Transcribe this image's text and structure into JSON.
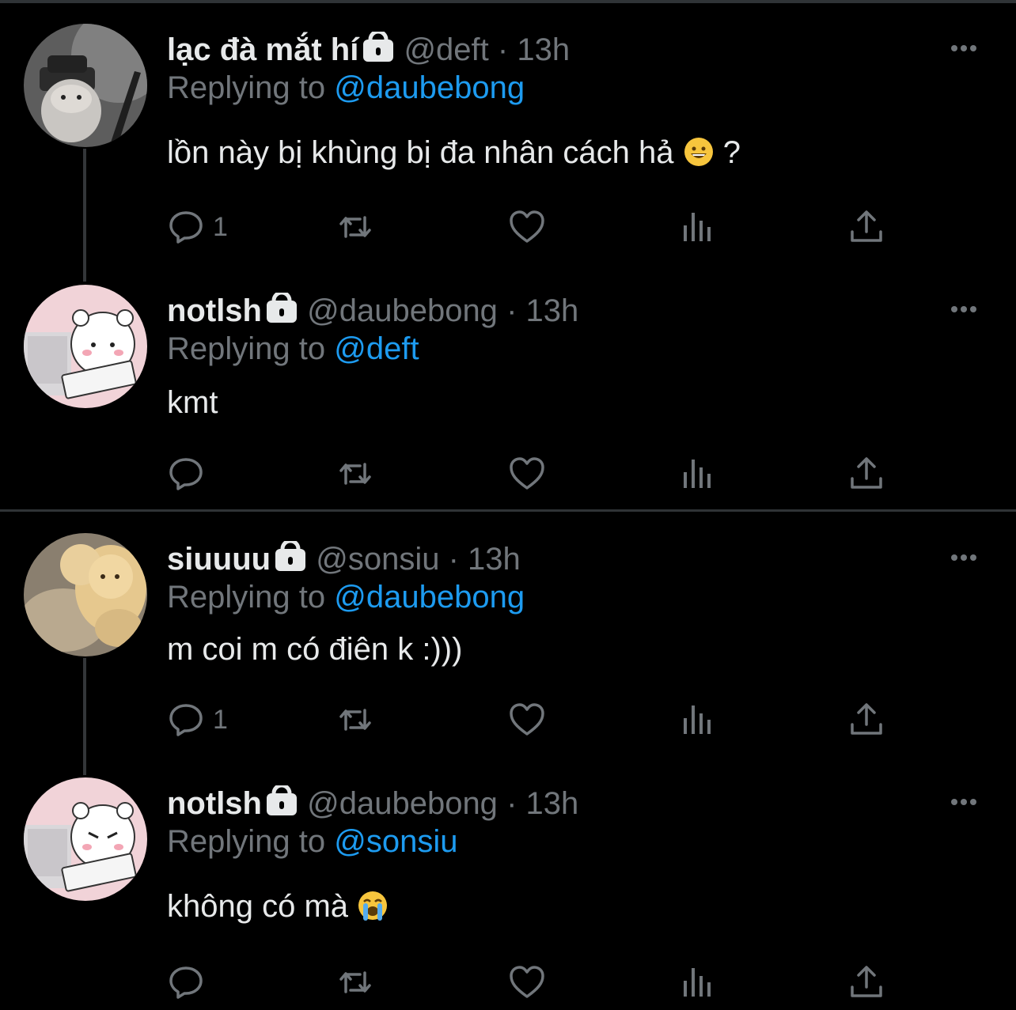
{
  "tweets": [
    {
      "name": "lạc đà mắt hí",
      "handle": "@deft",
      "dot": "·",
      "time": "13h",
      "reply_prefix": "Replying to",
      "reply_mention": "@daubebong",
      "text": "lồn này bị khùng bị đa nhân cách hả",
      "text_suffix": "?",
      "emoji": "grinning-face",
      "reply_count": "1",
      "avatar": "gray-plush-with-hat"
    },
    {
      "name": "notlsh",
      "handle": "@daubebong",
      "dot": "·",
      "time": "13h",
      "reply_prefix": "Replying to",
      "reply_mention": "@deft",
      "text": "kmt",
      "reply_count": "",
      "avatar": "cartoon-bear-at-keyboard"
    },
    {
      "name": "siuuuu",
      "handle": "@sonsiu",
      "dot": "·",
      "time": "13h",
      "reply_prefix": "Replying to",
      "reply_mention": "@daubebong",
      "text": "m coi m có điên k :)))",
      "reply_count": "1",
      "avatar": "teddy-bear-photo"
    },
    {
      "name": "notlsh",
      "handle": "@daubebong",
      "dot": "·",
      "time": "13h",
      "reply_prefix": "Replying to",
      "reply_mention": "@sonsiu",
      "text": "không có mà",
      "emoji": "loudly-crying-face",
      "reply_count": "",
      "avatar": "cartoon-bear-at-keyboard"
    }
  ],
  "icons": {
    "lock": "lock-icon",
    "more": "more-icon",
    "reply": "reply-icon",
    "retweet": "retweet-icon",
    "like": "like-icon",
    "views": "views-icon",
    "share": "share-icon"
  },
  "colors": {
    "background": "#000000",
    "text": "#e7e9ea",
    "muted": "#71767b",
    "link": "#1d9bf0",
    "divider": "#2f3336"
  }
}
